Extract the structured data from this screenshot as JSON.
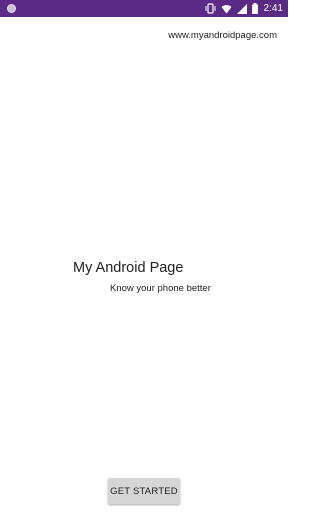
{
  "status_bar": {
    "time": "2:41",
    "background_color": "#5b2a86",
    "icons": [
      "notification-dot-icon",
      "vibrate-icon",
      "wifi-icon",
      "cellular-signal-icon",
      "battery-icon"
    ]
  },
  "header": {
    "url": "www.myandroidpage.com"
  },
  "main": {
    "title": "My Android Page",
    "subtitle": "Know your phone better"
  },
  "actions": {
    "start_label": "GET STARTED"
  }
}
